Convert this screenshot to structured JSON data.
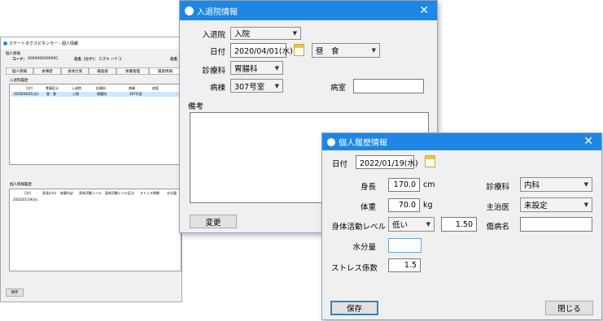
{
  "background_window": {
    "title": "ステートタグスピネンラー - 個人情報",
    "header_label": "個人情報",
    "code_label": "コード：",
    "code_value": "000000000000C",
    "name_label": "氏名（カナ）：",
    "name_value": "スズキ ハナコ",
    "name_label2": "氏名",
    "tabs": [
      "個人情報",
      "食事歴",
      "身体計測",
      "検査値",
      "栄養管理",
      "履歴情報"
    ],
    "section1_label": "入退院履歴",
    "grid1_headers": [
      "日付",
      "食事区分",
      "入退院",
      "診療科",
      "病棟",
      "病室"
    ],
    "grid1_row": [
      "2020/04/01(水)",
      "昼　食",
      "入院",
      "胃腸科",
      "307号室",
      ""
    ],
    "section2_label": "個人情報履歴",
    "grid2_headers": [
      "日付",
      "身長(cm)",
      "体重(kg)",
      "身体活動レベル",
      "身体活動レベル区分",
      "ストレス係数",
      "水分量"
    ],
    "grid2_row": [
      "2022/01/19(水)"
    ],
    "save_label": "保存"
  },
  "admission_dialog": {
    "title": "入退院情報",
    "admission_label": "入退院",
    "admission_value": "入院",
    "date_label": "日付",
    "date_value": "2020/04/01(水)",
    "meal_value": "昼　食",
    "department_label": "診療科",
    "department_value": "胃腸科",
    "ward_label": "病棟",
    "ward_value": "307号室",
    "room_label": "病室",
    "room_value": "",
    "notes_label": "備考",
    "notes_value": "",
    "change_label": "変更"
  },
  "personal_dialog": {
    "title": "個人履歴情報",
    "date_label": "日付",
    "date_value": "2022/01/19(水)",
    "height_label": "身長",
    "height_value": "170.0",
    "height_unit": "cm",
    "weight_label": "体重",
    "weight_value": "70.0",
    "weight_unit": "kg",
    "activity_label": "身体活動レベル",
    "activity_value": "低い",
    "activity_number": "1.50",
    "water_label": "水分量",
    "water_value": "",
    "stress_label": "ストレス係数",
    "stress_value": "1.5",
    "department_label": "診療科",
    "department_value": "内科",
    "doctor_label": "主治医",
    "doctor_value": "未設定",
    "disease_label": "傷病名",
    "disease_value": "",
    "save_label": "保存",
    "close_label": "閉じる"
  },
  "icons": {
    "close": "close-icon",
    "calendar": "calendar-icon",
    "app": "app-logo-icon",
    "dropdown": "chevron-down-icon"
  },
  "colors": {
    "titlebar": "#1e87e5",
    "selection": "#cde8ff"
  }
}
